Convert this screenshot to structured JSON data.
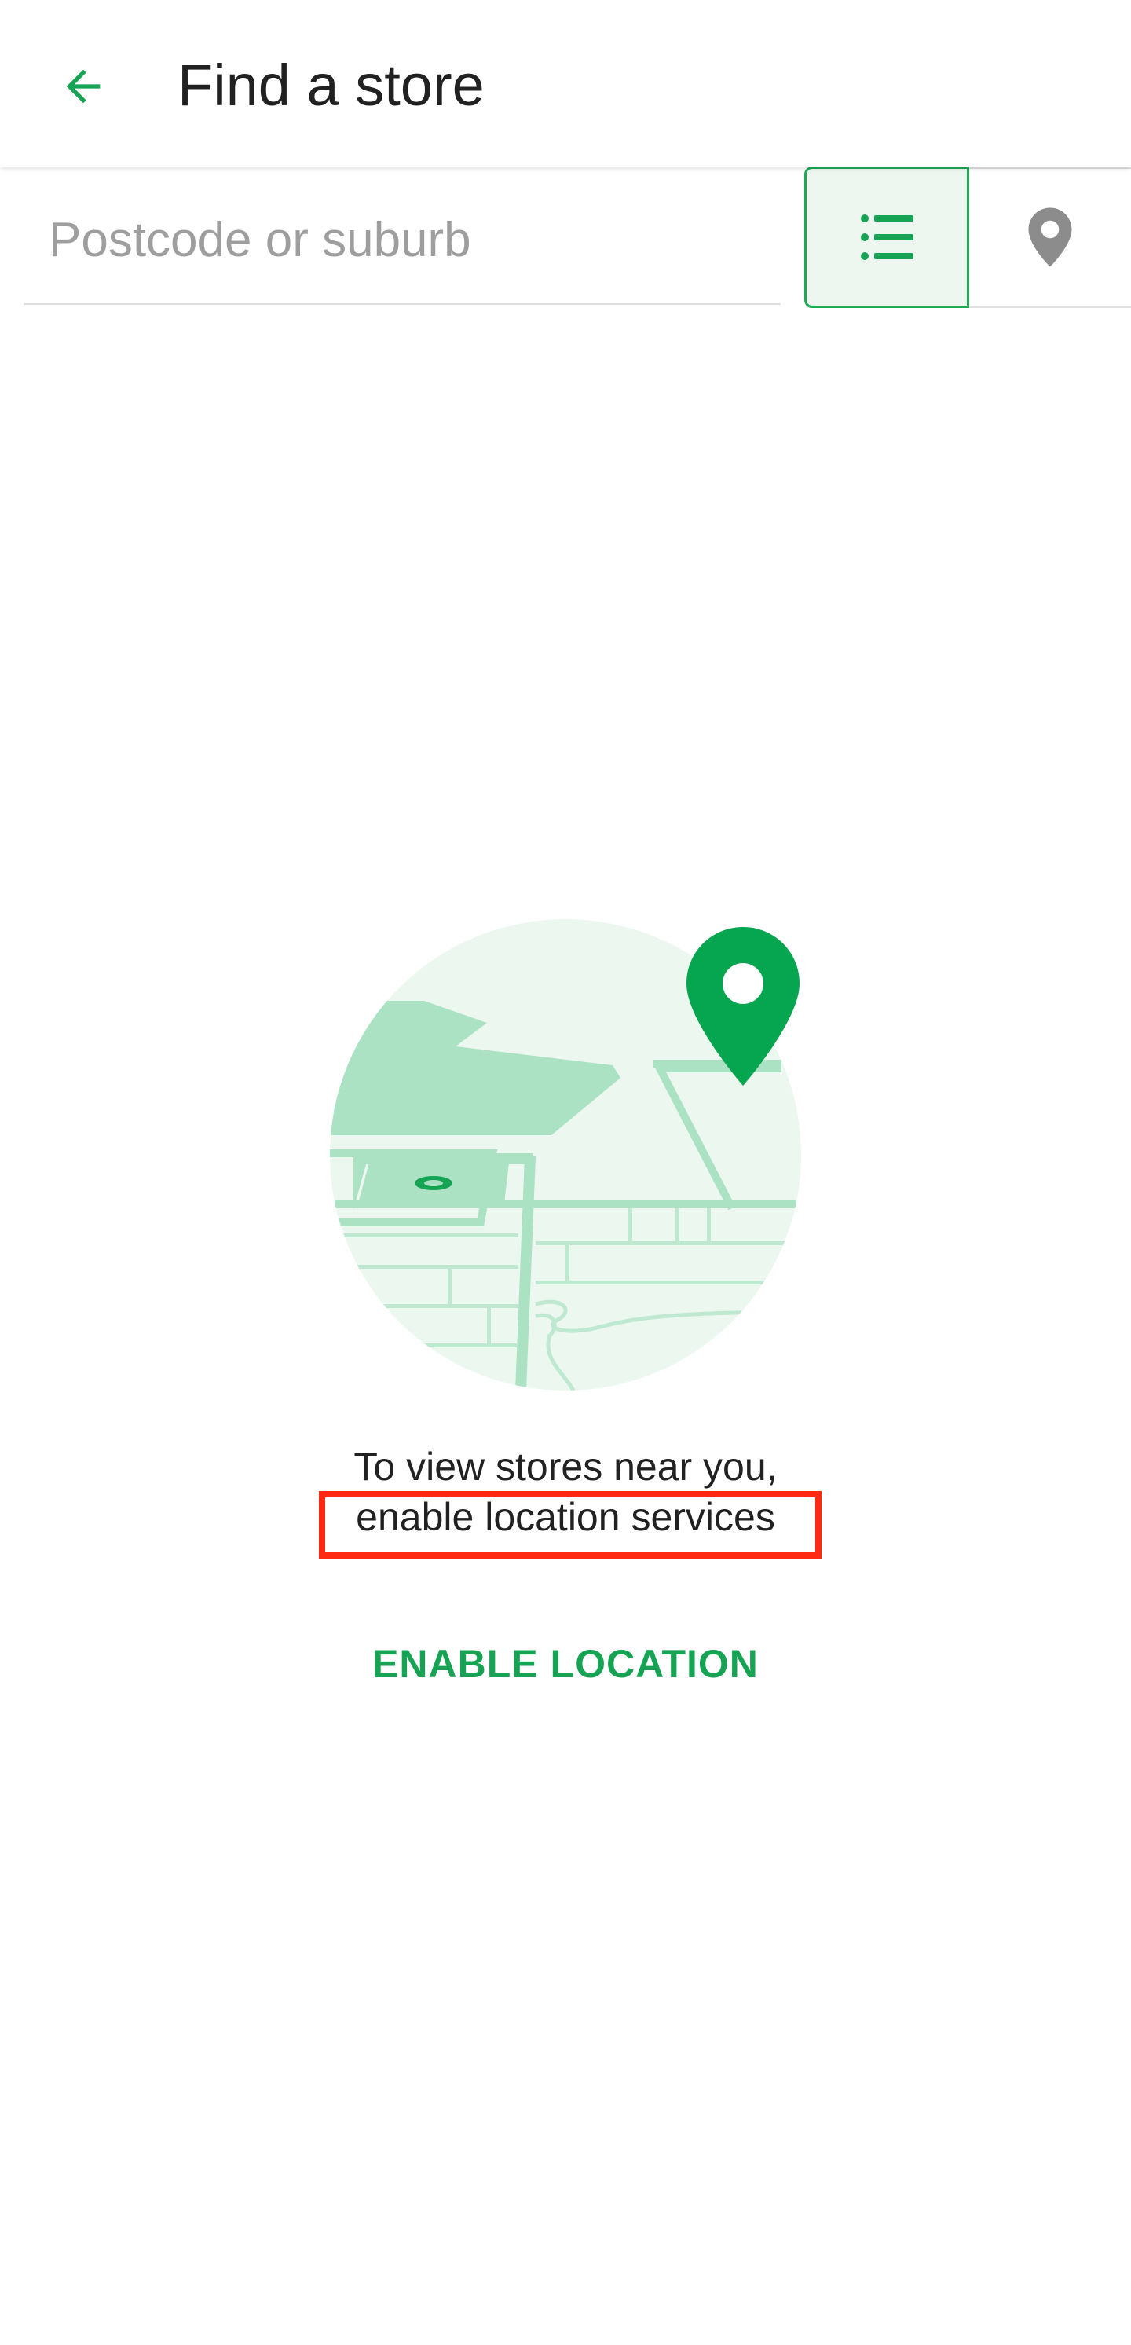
{
  "colors": {
    "accent": "#17a354",
    "accent_light": "#edf7f0",
    "highlight": "#ff2a12",
    "placeholder": "#9e9e9e",
    "icon_grey": "#8c8c8c"
  },
  "header": {
    "back_icon": "arrow-back-icon",
    "title": "Find a store"
  },
  "search": {
    "placeholder": "Postcode or suburb",
    "value": ""
  },
  "view_toggle": {
    "list_icon": "list-icon",
    "map_icon": "location-pin-icon",
    "selected": "list"
  },
  "empty_state": {
    "illustration_icon": "map-location-illustration",
    "message_line_1": "To view stores near you,",
    "message_line_2": "enable location services",
    "action_label": "ENABLE LOCATION"
  }
}
